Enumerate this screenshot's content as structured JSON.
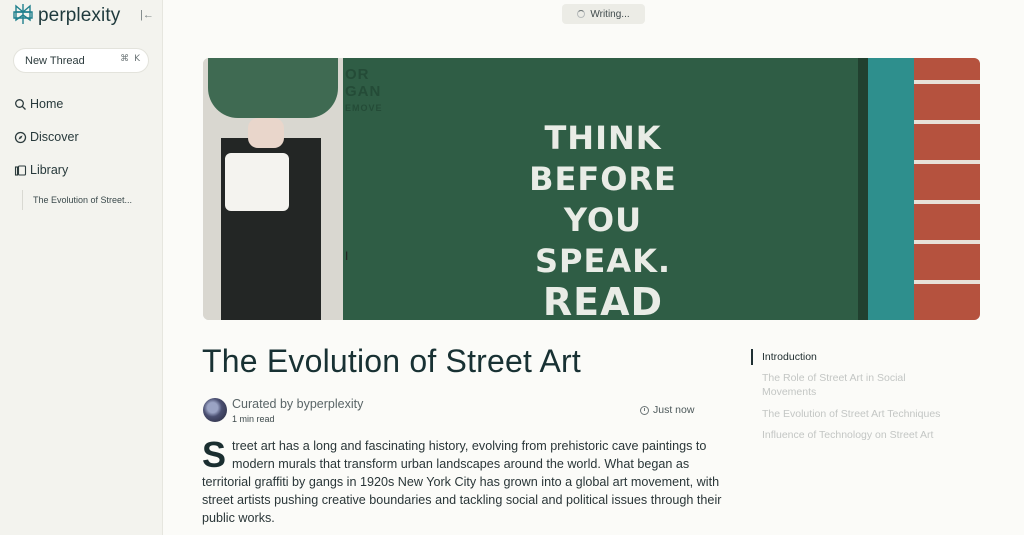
{
  "brand": {
    "name": "perplexity",
    "color": "#20808d"
  },
  "sidebar": {
    "new_thread": {
      "label": "New Thread",
      "shortcut_mod": "⌘",
      "shortcut_key": "K"
    },
    "nav": [
      {
        "label": "Home",
        "icon": "search-icon"
      },
      {
        "label": "Discover",
        "icon": "compass-icon"
      },
      {
        "label": "Library",
        "icon": "library-icon"
      }
    ],
    "threads": [
      "The Evolution of Street..."
    ]
  },
  "status": {
    "label": "Writing..."
  },
  "hero": {
    "stencil_lines": [
      "THINK",
      "BEFORE",
      "YOU",
      "SPEAK.",
      "READ"
    ],
    "top_text": [
      "OR",
      "GAN",
      "EMOVE"
    ]
  },
  "article": {
    "title": "The Evolution of Street Art",
    "curator": "Curated by byperplexity",
    "read_time": "1 min read",
    "posted": "Just now",
    "dropcap": "S",
    "body": "treet art has a long and fascinating history, evolving from prehistoric cave paintings to modern murals that transform urban landscapes around the world. What began as territorial graffiti by gangs in 1920s New York City has grown into a global art movement, with street artists pushing creative boundaries and tackling social and political issues through their public works."
  },
  "toc": [
    {
      "label": "Introduction",
      "active": true
    },
    {
      "label": "The Role of Street Art in Social Movements",
      "active": false
    },
    {
      "label": "The Evolution of Street Art Techniques",
      "active": false
    },
    {
      "label": "Influence of Technology on Street Art",
      "active": false
    }
  ]
}
